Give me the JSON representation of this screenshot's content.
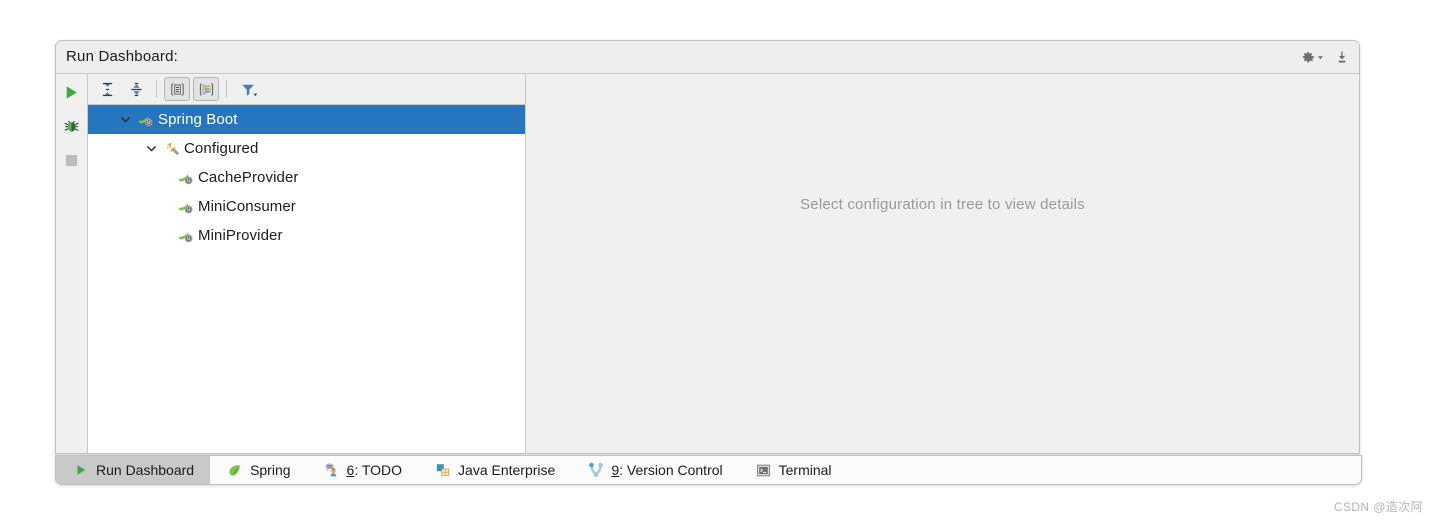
{
  "window": {
    "title": "Run Dashboard:",
    "header_actions": [
      {
        "name": "settings-gear-dropdown",
        "icon": "gear-icon",
        "label": "Settings"
      },
      {
        "name": "hide-window",
        "icon": "hide-icon",
        "label": "Hide"
      }
    ]
  },
  "run_toolbar": {
    "buttons": [
      {
        "name": "run-button",
        "icon": "play-icon",
        "label": "Run",
        "enabled": true
      },
      {
        "name": "debug-button",
        "icon": "bug-icon",
        "label": "Debug",
        "enabled": true
      },
      {
        "name": "stop-button",
        "icon": "stop-icon",
        "label": "Stop",
        "enabled": false
      }
    ]
  },
  "tree_toolbar": {
    "buttons": [
      {
        "name": "expand-all-button",
        "icon": "expand-all-icon",
        "label": "Expand All",
        "pressed": false
      },
      {
        "name": "collapse-all-button",
        "icon": "collapse-all-icon",
        "label": "Collapse All",
        "pressed": false
      },
      {
        "name": "show-configurations-button",
        "icon": "document-brackets-icon",
        "label": "Show Configurations",
        "pressed": true
      },
      {
        "name": "group-by-type-button",
        "icon": "colored-list-brackets-icon",
        "label": "Group Nodes",
        "pressed": true
      },
      {
        "name": "filter-button",
        "icon": "filter-icon",
        "label": "Filter",
        "pressed": false
      }
    ]
  },
  "tree": {
    "nodes": [
      {
        "label": "Spring Boot",
        "icon": "spring-boot-run-icon",
        "indent": 0,
        "expanded": true,
        "has_twisty": true,
        "selected": true
      },
      {
        "label": "Configured",
        "icon": "wrench-gear-icon",
        "indent": 1,
        "expanded": true,
        "has_twisty": true,
        "selected": false
      },
      {
        "label": "CacheProvider",
        "icon": "spring-boot-run-icon",
        "indent": 2,
        "expanded": false,
        "has_twisty": false,
        "selected": false
      },
      {
        "label": "MiniConsumer",
        "icon": "spring-boot-run-icon",
        "indent": 2,
        "expanded": false,
        "has_twisty": false,
        "selected": false
      },
      {
        "label": "MiniProvider",
        "icon": "spring-boot-run-icon",
        "indent": 2,
        "expanded": false,
        "has_twisty": false,
        "selected": false
      }
    ]
  },
  "details_pane": {
    "empty_text": "Select configuration in tree to view details"
  },
  "tab_bar": {
    "tabs": [
      {
        "name": "tab-run-dashboard",
        "label": "Run Dashboard",
        "icon": "play-icon",
        "mnemonic": "",
        "active": true
      },
      {
        "name": "tab-spring",
        "label": "Spring",
        "icon": "spring-leaf-icon",
        "mnemonic": "",
        "active": false
      },
      {
        "name": "tab-todo",
        "label": ": TODO",
        "icon": "todo-icon",
        "mnemonic": "6",
        "active": false
      },
      {
        "name": "tab-java-enterprise",
        "label": "Java Enterprise",
        "icon": "java-enterprise-icon",
        "mnemonic": "",
        "active": false
      },
      {
        "name": "tab-version-control",
        "label": ": Version Control",
        "icon": "version-control-icon",
        "mnemonic": "9",
        "active": false
      },
      {
        "name": "tab-terminal",
        "label": "Terminal",
        "icon": "terminal-icon",
        "mnemonic": "",
        "active": false
      }
    ]
  },
  "watermark": {
    "text": "CSDN @造次阿"
  },
  "colors": {
    "selection_blue": "#2575bf",
    "panel_bg": "#f0f0f0",
    "tree_bg": "#ffffff",
    "active_tab_bg": "#c9c9c9",
    "border": "#c8c8c8",
    "spring_green": "#6db33f",
    "muted_text": "#9a9a9a"
  }
}
